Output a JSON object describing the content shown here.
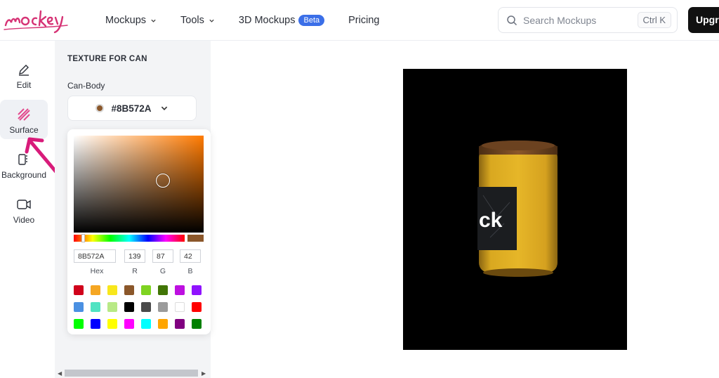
{
  "header": {
    "brand": "mockey",
    "nav": [
      {
        "label": "Mockups",
        "has_dropdown": true
      },
      {
        "label": "Tools",
        "has_dropdown": true
      },
      {
        "label": "3D Mockups",
        "badge": "Beta"
      },
      {
        "label": "Pricing"
      }
    ],
    "search": {
      "placeholder": "Search Mockups",
      "shortcut": "Ctrl K"
    },
    "upgrade_label": "Upgra"
  },
  "rail": {
    "items": [
      {
        "label": "Edit",
        "icon": "pencil-icon",
        "active": false
      },
      {
        "label": "Surface",
        "icon": "hatched-square-icon",
        "active": true
      },
      {
        "label": "Background",
        "icon": "background-icon",
        "active": false
      },
      {
        "label": "Video",
        "icon": "video-camera-icon",
        "active": false
      }
    ]
  },
  "panel": {
    "title": "TEXTURE FOR CAN",
    "field_label": "Can-Body",
    "selected_color": "#8B572A",
    "picker": {
      "hex": "8B572A",
      "r": "139",
      "g": "87",
      "b": "42",
      "labels": {
        "hex": "Hex",
        "r": "R",
        "g": "G",
        "b": "B"
      },
      "presets": [
        "#d0021b",
        "#f5a623",
        "#f8e71c",
        "#8b572a",
        "#7ed321",
        "#417505",
        "#bd10e0",
        "#9013fe",
        "#4a90e2",
        "#50e3c2",
        "#b8e986",
        "#000000",
        "#4a4a4a",
        "#9b9b9b",
        "#ffffff",
        "#ff0000",
        "#00ff00",
        "#0000ff",
        "#ffff00",
        "#ff00ff",
        "#00ffff",
        "#ffa500",
        "#800080",
        "#008000"
      ]
    }
  },
  "canvas": {
    "label_text": "ck",
    "can_color": "#e3b224",
    "lid_color": "#8b572a"
  },
  "annotation": {
    "arrow_color": "#d81b7a"
  }
}
